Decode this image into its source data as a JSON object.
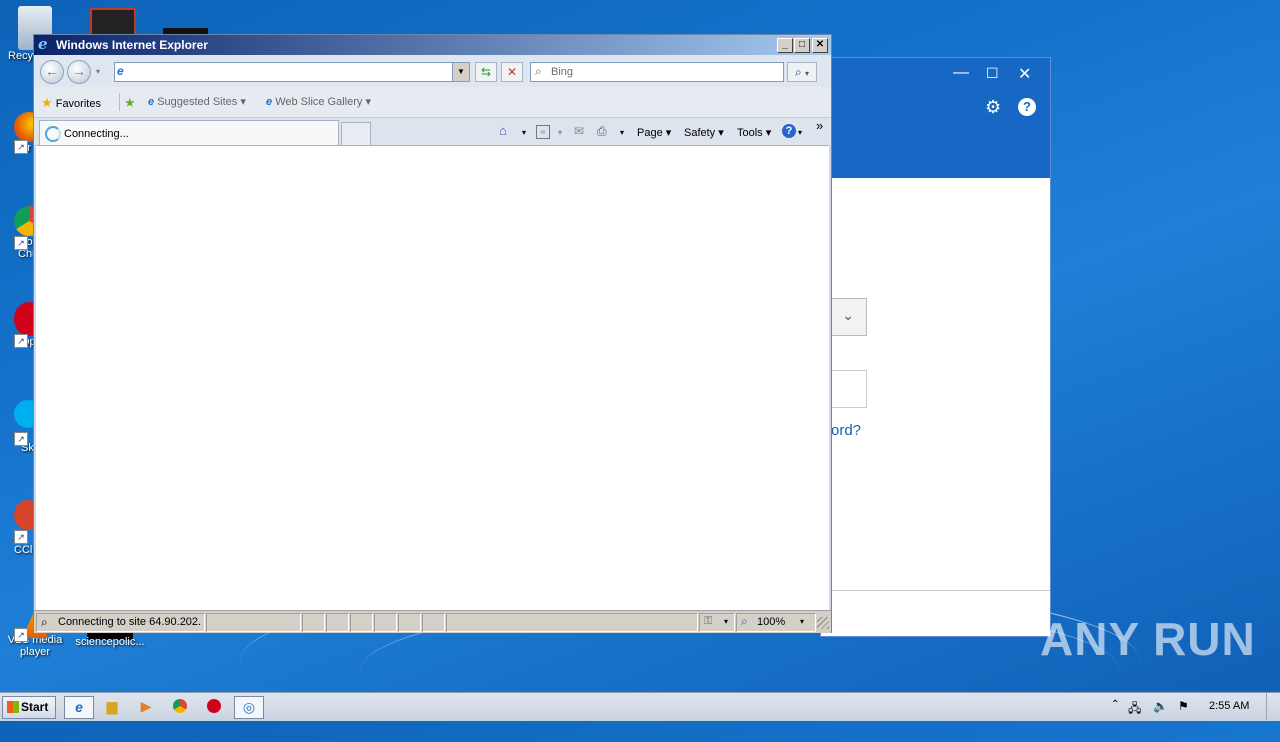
{
  "desktop": {
    "icons": [
      {
        "label": "Recy"
      },
      {
        "label": "Fir"
      },
      {
        "label": "Go Chr"
      },
      {
        "label": "Op"
      },
      {
        "label": "Sk"
      },
      {
        "label": "CCl"
      },
      {
        "label": "VLC media player"
      },
      {
        "label": "sciencepolic..."
      }
    ]
  },
  "bg_window": {
    "controls": {
      "minimize": "—",
      "maximize": "☐",
      "close": "✕"
    },
    "settings_icon": "gear-icon",
    "help_label": "?",
    "chevron": "⌄",
    "link_text": "ord?"
  },
  "ie": {
    "title": "Windows Internet Explorer",
    "window_controls": {
      "minimize": "_",
      "maximize": "□",
      "close": "✕"
    },
    "address_value": "",
    "search_placeholder": "Bing",
    "favorites": {
      "favorites_label": "Favorites",
      "suggested_label": "Suggested Sites ▾",
      "slice_label": "Web Slice Gallery ▾"
    },
    "tab": {
      "label": "Connecting..."
    },
    "commands": {
      "page": "Page ▾",
      "safety": "Safety ▾",
      "tools": "Tools ▾",
      "help": "?",
      "more": "»"
    },
    "status": {
      "text": "Connecting to site 64.90.202.",
      "zoom": "100%"
    }
  },
  "taskbar": {
    "start_label": "Start",
    "clock": "2:55 AM"
  },
  "watermark": "ANY RUN"
}
